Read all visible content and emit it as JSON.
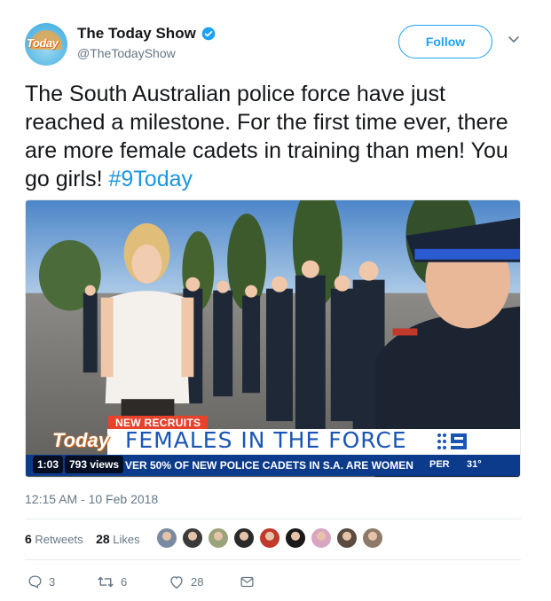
{
  "account": {
    "name": "The Today Show",
    "handle": "@TheTodayShow",
    "avatar_logo_text": "Today",
    "verified": true
  },
  "actions_top": {
    "follow_label": "Follow"
  },
  "tweet": {
    "text": "The South Australian police force have just reached a milestone. For the first time ever, there are more female cadets in training than men! You go girls! ",
    "hashtag": "#9Today",
    "timestamp": "12:15 AM - 10 Feb 2018"
  },
  "video": {
    "duration": "1:03",
    "views": "793 views",
    "overlay": {
      "show_logo": "Today",
      "tag": "NEW RECRUITS",
      "headline": "FEMALES IN THE FORCE",
      "ticker": "VER 50% OF NEW POLICE CADETS IN S.A. ARE WOMEN",
      "city": "PER",
      "temperature": "31°"
    }
  },
  "stats": {
    "retweets_count": "6",
    "retweets_label": "Retweets",
    "likes_count": "28",
    "likes_label": "Likes",
    "liker_colors": [
      "#7a8aa0",
      "#3b3b3b",
      "#9aa47a",
      "#2a2a2a",
      "#c0392b",
      "#1a1a1a",
      "#d8a6c2",
      "#5a4a40",
      "#8f7a6a"
    ]
  },
  "footer_actions": {
    "replies": "3",
    "retweets": "6",
    "likes": "28"
  },
  "colors": {
    "accent": "#1da1f2",
    "hashtag": "#1b95e0",
    "muted": "#657786"
  }
}
